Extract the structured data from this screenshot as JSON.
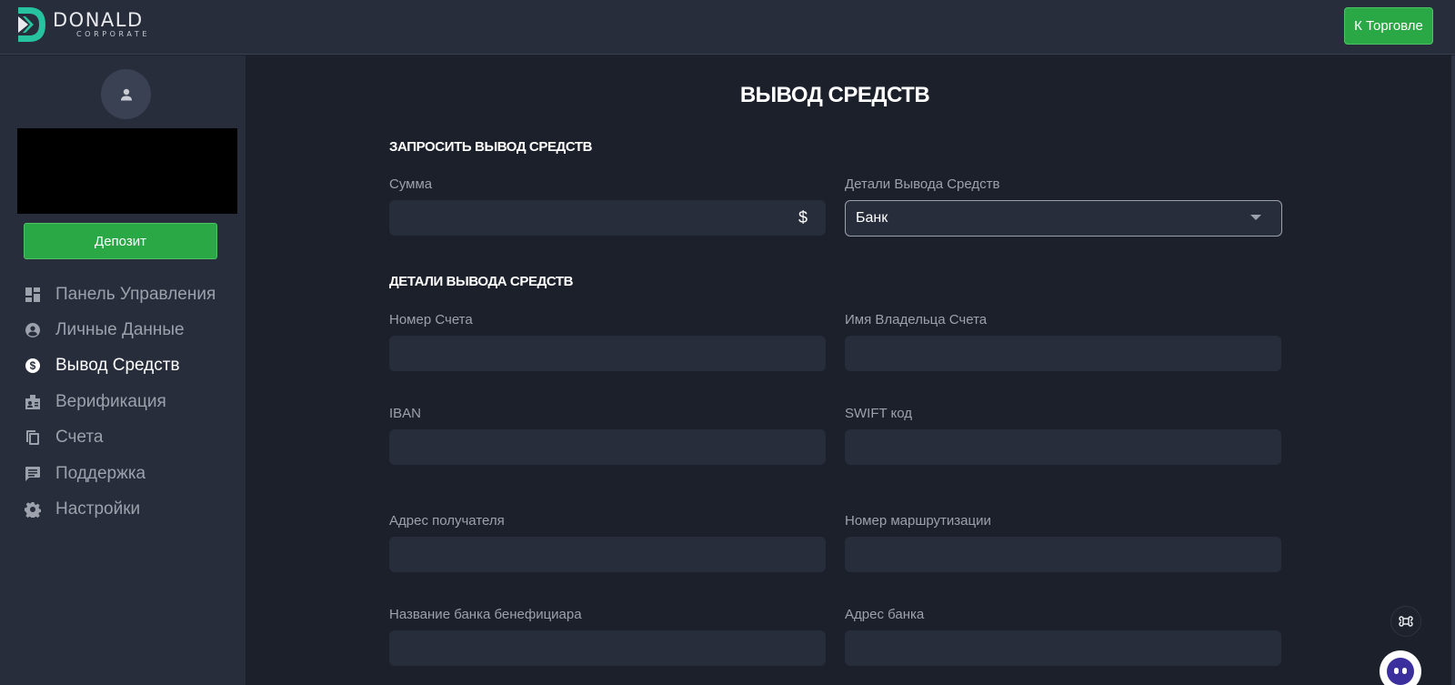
{
  "header": {
    "brand_name": "DONALD",
    "brand_sub": "CORPORATE",
    "trade_button": "К Торговле",
    "accent_color": "#2aa845",
    "logo_color": "#27c3a0"
  },
  "sidebar": {
    "avatar_icon": "user-icon",
    "deposit_button": "Депозит",
    "items": [
      {
        "label": "Панель Управления",
        "icon": "dashboard-icon",
        "active": false
      },
      {
        "label": "Личные Данные",
        "icon": "account-circle-icon",
        "active": false
      },
      {
        "label": "Вывод Средств",
        "icon": "dollar-circle-icon",
        "active": true
      },
      {
        "label": "Верификация",
        "icon": "badge-icon",
        "active": false
      },
      {
        "label": "Счета",
        "icon": "copy-icon",
        "active": false
      },
      {
        "label": "Поддержка",
        "icon": "chat-icon",
        "active": false
      },
      {
        "label": "Настройки",
        "icon": "gear-icon",
        "active": false
      }
    ]
  },
  "main": {
    "title": "ВЫВОД СРЕДСТВ",
    "request_section": {
      "title": "ЗАПРОСИТЬ ВЫВОД СРЕДСТВ",
      "amount_label": "Сумма",
      "amount_value": "",
      "amount_suffix": "$",
      "method_label": "Детали Вывода Средств",
      "method_value": "Банк"
    },
    "details_section": {
      "title": "ДЕТАЛИ ВЫВОДА СРЕДСТВ",
      "fields": [
        {
          "label": "Номер Счета",
          "value": ""
        },
        {
          "label": "Имя Владельца Счета",
          "value": ""
        },
        {
          "label": "IBAN",
          "value": ""
        },
        {
          "label": "SWIFT код",
          "value": ""
        },
        {
          "label": "Адрес получателя",
          "value": ""
        },
        {
          "label": "Номер маршрутизации",
          "value": ""
        },
        {
          "label": "Название банка бенефициара",
          "value": ""
        },
        {
          "label": "Адрес банка",
          "value": ""
        }
      ]
    }
  },
  "widgets": {
    "command_icon": "command-icon",
    "chat_bot_icon": "chatbot-icon"
  }
}
